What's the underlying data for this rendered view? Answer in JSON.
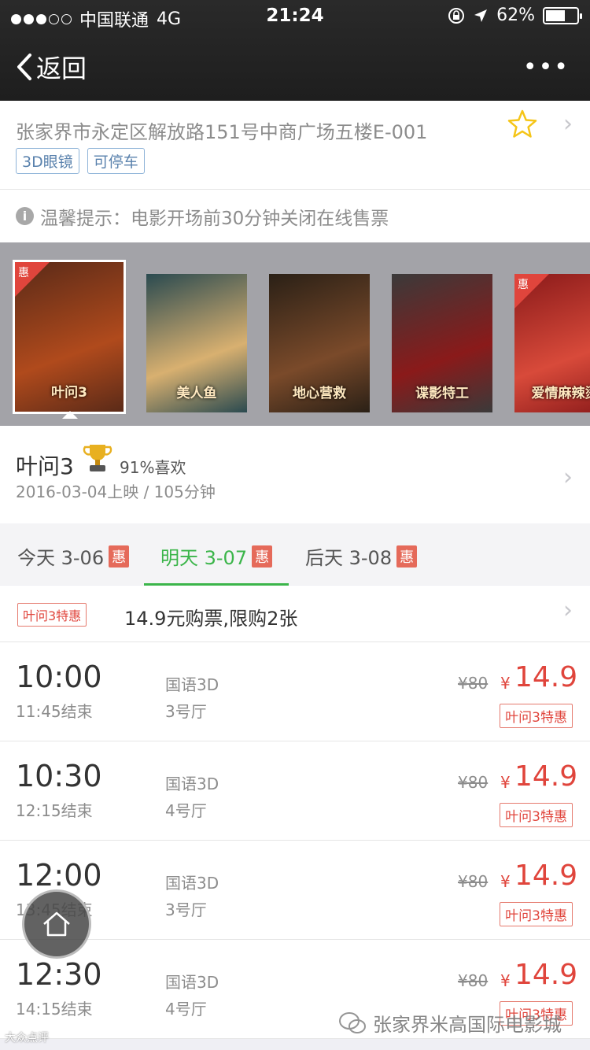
{
  "status_bar": {
    "carrier": "中国联通",
    "network": "4G",
    "time": "21:24",
    "battery": "62%",
    "battery_level": 0.62
  },
  "nav": {
    "back_label": "返回",
    "more_label": "•••"
  },
  "cinema": {
    "name_partial": "张家界米高国际电影城",
    "address": "张家界市永定区解放路151号中商广场五楼E-001",
    "tags": [
      "3D眼镜",
      "可停车"
    ]
  },
  "tip": {
    "text": "温馨提示：电影开场前30分钟关闭在线售票"
  },
  "posters": [
    {
      "title": "叶问3",
      "badge": "惠",
      "selected": true,
      "colors": [
        "#5a2a18",
        "#b04a1c"
      ]
    },
    {
      "title": "美人鱼",
      "badge": "",
      "selected": false,
      "colors": [
        "#2a4a50",
        "#d8b070"
      ]
    },
    {
      "title": "地心营救",
      "badge": "",
      "selected": false,
      "colors": [
        "#2a2016",
        "#7a4a2a"
      ]
    },
    {
      "title": "谍影特工",
      "badge": "",
      "selected": false,
      "colors": [
        "#3a3a3a",
        "#8a1a1a"
      ]
    },
    {
      "title": "爱情麻辣烫",
      "badge": "惠",
      "selected": false,
      "colors": [
        "#8a1a1a",
        "#d84a3a"
      ]
    }
  ],
  "movie": {
    "title": "叶问3",
    "like": "91%喜欢",
    "meta": "2016-03-04上映 / 105分钟"
  },
  "dates": [
    {
      "label": "今天 3-06",
      "badge": "惠",
      "active": false
    },
    {
      "label": "明天 3-07",
      "badge": "惠",
      "active": true
    },
    {
      "label": "后天 3-08",
      "badge": "惠",
      "active": false
    }
  ],
  "promo": {
    "tag": "叶问3特惠",
    "text": "14.9元购票,限购2张"
  },
  "sessions": [
    {
      "start": "10:00",
      "end": "11:45结束",
      "lang": "国语3D",
      "hall": "3号厅",
      "orig": "¥80",
      "yen": "¥",
      "price": "14.9",
      "tag": "叶问3特惠"
    },
    {
      "start": "10:30",
      "end": "12:15结束",
      "lang": "国语3D",
      "hall": "4号厅",
      "orig": "¥80",
      "yen": "¥",
      "price": "14.9",
      "tag": "叶问3特惠"
    },
    {
      "start": "12:00",
      "end": "13:45结束",
      "lang": "国语3D",
      "hall": "3号厅",
      "orig": "¥80",
      "yen": "¥",
      "price": "14.9",
      "tag": "叶问3特惠"
    },
    {
      "start": "12:30",
      "end": "14:15结束",
      "lang": "国语3D",
      "hall": "4号厅",
      "orig": "¥80",
      "yen": "¥",
      "price": "14.9",
      "tag": "叶问3特惠"
    }
  ],
  "watermark": {
    "text": "张家界米高国际电影城",
    "source": "大众点评"
  },
  "colors": {
    "accent_green": "#3bb54a",
    "price_red": "#e0453c",
    "nav_bg": "#262626"
  }
}
